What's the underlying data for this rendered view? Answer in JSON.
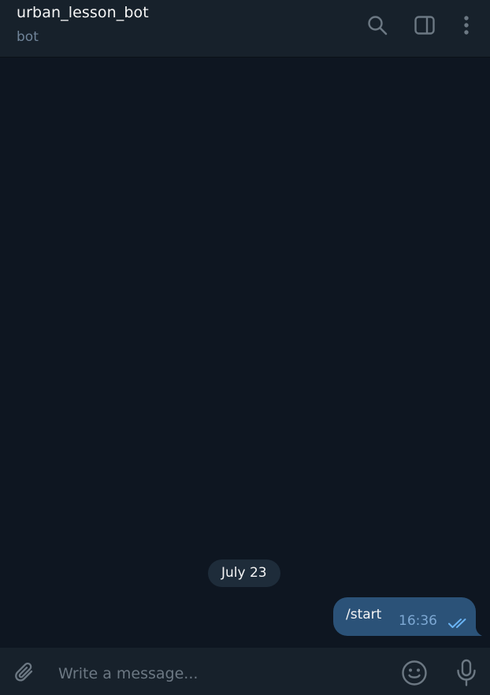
{
  "header": {
    "title": "urban_lesson_bot",
    "subtitle": "bot",
    "icons": [
      "search-icon",
      "sidebar-toggle-icon",
      "more-vertical-icon"
    ]
  },
  "messages": {
    "date_separator": "July 23",
    "items": [
      {
        "direction": "outgoing",
        "text": "/start",
        "time": "16:36",
        "status": "read",
        "status_icon": "double-check-icon"
      }
    ]
  },
  "composer": {
    "placeholder": "Write a message...",
    "value": "",
    "icons": [
      "paperclip-icon",
      "emoji-icon",
      "microphone-icon"
    ]
  },
  "colors": {
    "background": "#0e1621",
    "panel": "#17212b",
    "outgoing_bubble": "#2b5278",
    "date_pill": "#1e2c3a",
    "muted_text": "#708499",
    "icon": "#6c7883",
    "check_color": "#6ab3f3"
  }
}
